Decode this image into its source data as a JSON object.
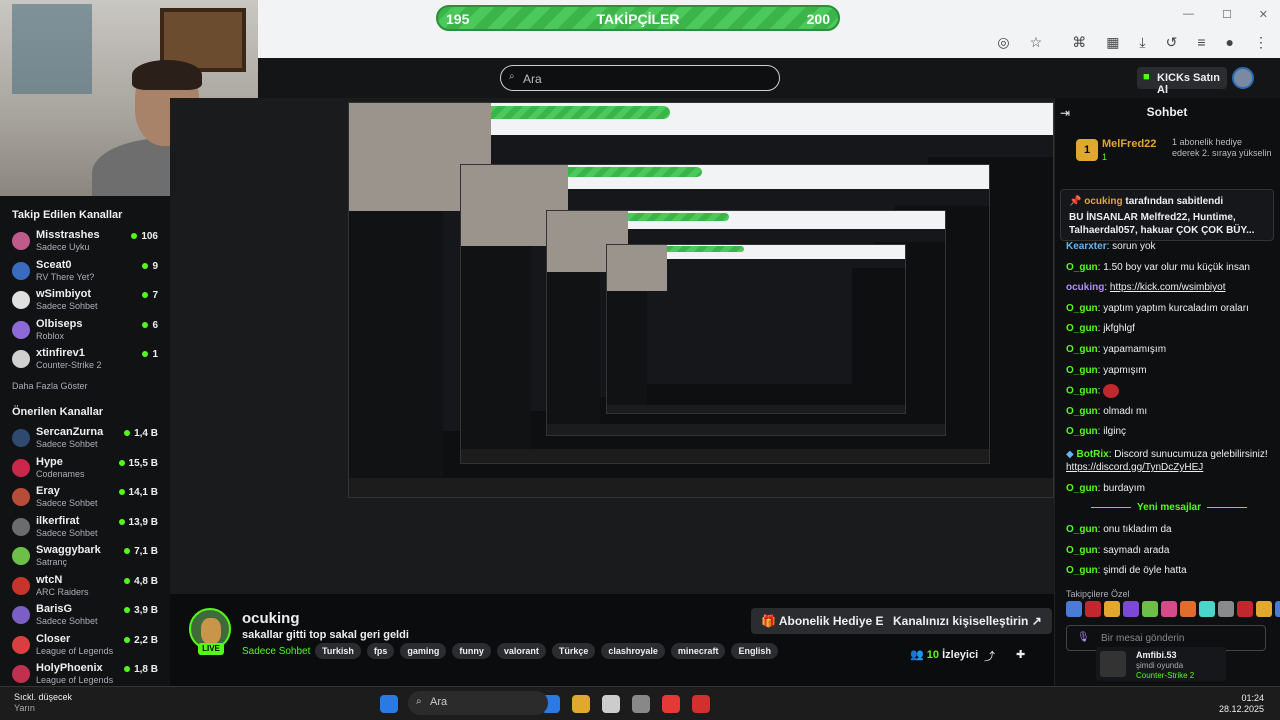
{
  "follower_goal": {
    "left": "195",
    "title": "TAKİPÇİLER",
    "right": "200"
  },
  "header": {
    "search_placeholder": "Ara",
    "kicks_button": "KICKs Satın Al"
  },
  "sidebar": {
    "followed_title": "Takip Edilen Kanallar",
    "followed": [
      {
        "name": "Misstrashes",
        "sub": "Sadece Uyku",
        "count": "106",
        "color": "#c05a8a"
      },
      {
        "name": "Sceat0",
        "sub": "RV There Yet?",
        "count": "9",
        "color": "#3a6bbf"
      },
      {
        "name": "wSimbiyot",
        "sub": "Sadece Sohbet",
        "count": "7",
        "color": "#e0e0e0"
      },
      {
        "name": "Olbiseps",
        "sub": "Roblox",
        "count": "6",
        "color": "#8e6ad8"
      },
      {
        "name": "xtinfirev1",
        "sub": "Counter-Strike 2",
        "count": "1",
        "color": "#d0d0d0"
      }
    ],
    "more_label": "Daha Fazla Göster",
    "recommended_title": "Önerilen Kanallar",
    "recommended": [
      {
        "name": "SercanZurna",
        "sub": "Sadece Sohbet",
        "count": "1,4 B",
        "color": "#2f4a6e"
      },
      {
        "name": "Hype",
        "sub": "Codenames",
        "count": "15,5 B",
        "color": "#c9284a"
      },
      {
        "name": "Eray",
        "sub": "Sadece Sohbet",
        "count": "14,1 B",
        "color": "#b84c3a"
      },
      {
        "name": "ilkerfirat",
        "sub": "Sadece Sohbet",
        "count": "13,9 B",
        "color": "#6c6c6c"
      },
      {
        "name": "Swaggybark",
        "sub": "Satranç",
        "count": "7,1 B",
        "color": "#6dbf4a"
      },
      {
        "name": "wtcN",
        "sub": "ARC Raiders",
        "count": "4,8 B",
        "color": "#c8342c"
      },
      {
        "name": "BarisG",
        "sub": "Sadece Sohbet",
        "count": "3,9 B",
        "color": "#7b5fc4"
      },
      {
        "name": "Closer",
        "sub": "League of Legends",
        "count": "2,2 B",
        "color": "#d84040"
      },
      {
        "name": "HolyPhoenix",
        "sub": "League of Legends",
        "count": "1,8 B",
        "color": "#c23050"
      }
    ]
  },
  "stream": {
    "streamer": "ocuking",
    "live": "LIVE",
    "title": "sakallar gitti top sakal geri geldi",
    "category": "Sadece Sohbet",
    "tags": [
      "Turkish",
      "fps",
      "gaming",
      "funny",
      "valorant",
      "Türkçe",
      "clashroyale",
      "minecraft",
      "English"
    ],
    "gift_button": "Abonelik Hediye Et",
    "customize_button": "Kanalınızı kişiselleştirin",
    "viewers_count": "10",
    "viewers_label": "İzleyici"
  },
  "chat": {
    "title": "Sohbet",
    "gifter": {
      "name": "MelFred22",
      "rank": "1",
      "badge": "1",
      "text": "1 abonelik hediye ederek 2. sıraya yükselin"
    },
    "pinned": {
      "by": "ocuking",
      "by_suffix": "tarafından sabitlendi",
      "text": "BU İNSANLAR Melfred22, Huntime, Talhaerdal057, hakuar ÇOK ÇOK BÜY..."
    },
    "messages": [
      {
        "user": "Kearxter",
        "text": "sorun yok",
        "style": "u3"
      },
      {
        "user": "O_gun",
        "text": "1.50 boy var olur mu küçük insan",
        "style": "u"
      },
      {
        "user": "ocuking",
        "text": "https://kick.com/wsimbiyot",
        "style": "u2",
        "link": true
      },
      {
        "user": "O_gun",
        "text": "yaptım yaptım kurcaladım oraları",
        "style": "u"
      },
      {
        "user": "O_gun",
        "text": "jkfghlgf",
        "style": "u"
      },
      {
        "user": "O_gun",
        "text": "yapamamışım",
        "style": "u"
      },
      {
        "user": "O_gun",
        "text": "yapmışım",
        "style": "u"
      },
      {
        "user": "O_gun",
        "text": "",
        "style": "u"
      },
      {
        "user": "O_gun",
        "text": "olmadı mı",
        "style": "u"
      },
      {
        "user": "O_gun",
        "text": "ilginç",
        "style": "u"
      }
    ],
    "botrix_user": "BotRix",
    "botrix_text": "Discord sunucumuza gelebilirsiniz!",
    "botrix_link": "https://discord.gg/TynDcZyHEJ",
    "after_bot": {
      "user": "O_gun",
      "text": "burdayım"
    },
    "new_messages_label": "Yeni mesajlar",
    "new_messages": [
      {
        "user": "O_gun",
        "text": "onu tıkladım da"
      },
      {
        "user": "O_gun",
        "text": "saymadı arada"
      },
      {
        "user": "O_gun",
        "text": "şimdi de öyle hatta"
      }
    ],
    "followers_special": "Takipçilere Özel",
    "input_placeholder": "Bir mesai gönderin",
    "mini_card": {
      "name": "Amfibi.53",
      "status": "şimdi oyunda",
      "game": "Counter-Strike 2"
    }
  },
  "taskbar": {
    "weather_title": "Sıckl. düşecek",
    "weather_sub": "Yarın",
    "search_placeholder": "Ara",
    "time": "01:24",
    "date": "28.12.2025"
  }
}
